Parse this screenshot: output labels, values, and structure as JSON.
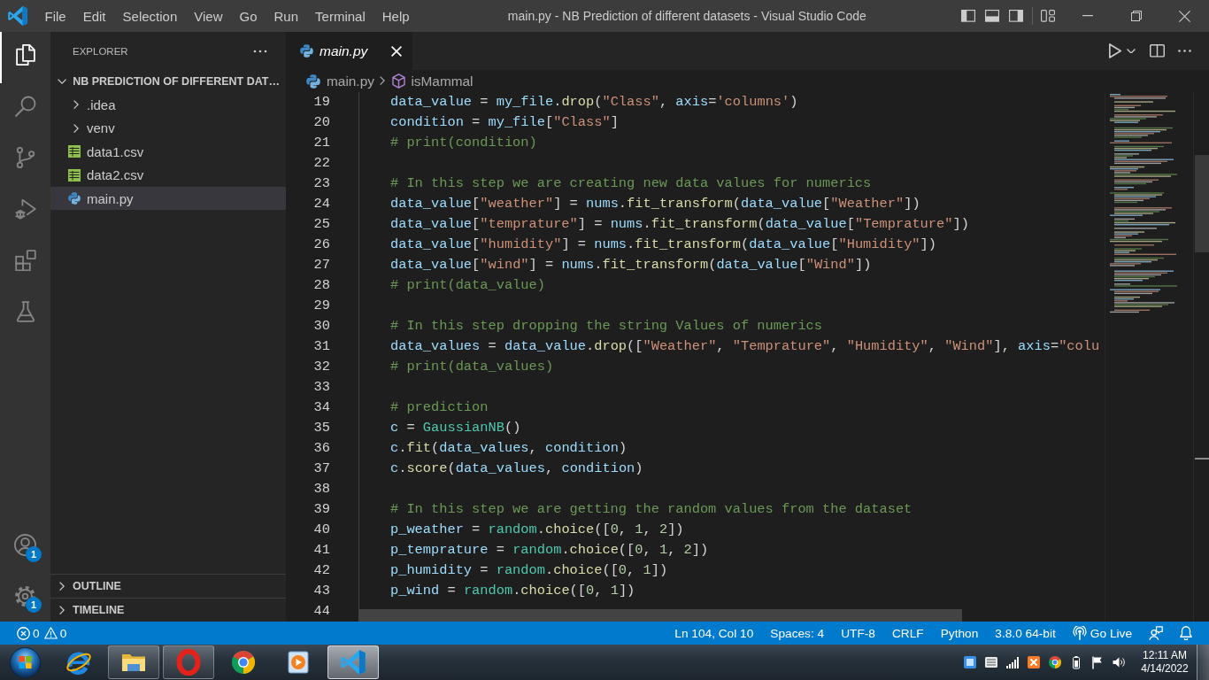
{
  "title_bar": {
    "menu": [
      "File",
      "Edit",
      "Selection",
      "View",
      "Go",
      "Run",
      "Terminal",
      "Help"
    ],
    "title": "main.py - NB Prediction of different datasets - Visual Studio Code"
  },
  "activity_bar": {
    "items": [
      {
        "selected": true
      },
      {
        "selected": false
      },
      {
        "selected": false
      },
      {
        "selected": false
      },
      {
        "selected": false
      },
      {
        "selected": false
      }
    ],
    "accounts_badge": "1",
    "settings_badge": "1"
  },
  "sidebar": {
    "title": "EXPLORER",
    "folder": {
      "label": "NB PREDICTION OF DIFFERENT DAT…",
      "expanded": true,
      "children": [
        {
          "kind": "folder",
          "label": ".idea",
          "expanded": false,
          "selected": false
        },
        {
          "kind": "folder",
          "label": "venv",
          "expanded": false,
          "selected": false
        },
        {
          "kind": "csv",
          "label": "data1.csv",
          "selected": false
        },
        {
          "kind": "csv",
          "label": "data2.csv",
          "selected": false
        },
        {
          "kind": "python",
          "label": "main.py",
          "selected": true
        }
      ]
    },
    "sections": [
      {
        "label": "OUTLINE",
        "expanded": false
      },
      {
        "label": "TIMELINE",
        "expanded": false
      }
    ]
  },
  "editor": {
    "tabs": [
      {
        "label": "main.py",
        "selected": true,
        "preview": true
      }
    ],
    "breadcrumbs": [
      {
        "kind": "file",
        "label": "main.py"
      },
      {
        "kind": "symbol",
        "label": "isMammal"
      }
    ],
    "lines": [
      {
        "number": "19",
        "tokens": [
          {
            "kind": "variable",
            "text": "data_value"
          },
          {
            "kind": "punctuation",
            "text": " = "
          },
          {
            "kind": "variable",
            "text": "my_file"
          },
          {
            "kind": "punctuation",
            "text": "."
          },
          {
            "kind": "function",
            "text": "drop"
          },
          {
            "kind": "punctuation",
            "text": "("
          },
          {
            "kind": "string",
            "text": "\"Class\""
          },
          {
            "kind": "punctuation",
            "text": ", "
          },
          {
            "kind": "variable",
            "text": "axis"
          },
          {
            "kind": "punctuation",
            "text": "="
          },
          {
            "kind": "string",
            "text": "'columns'"
          },
          {
            "kind": "punctuation",
            "text": ")"
          }
        ]
      },
      {
        "number": "20",
        "tokens": [
          {
            "kind": "variable",
            "text": "condition"
          },
          {
            "kind": "punctuation",
            "text": " = "
          },
          {
            "kind": "variable",
            "text": "my_file"
          },
          {
            "kind": "punctuation",
            "text": "["
          },
          {
            "kind": "string",
            "text": "\"Class\""
          },
          {
            "kind": "punctuation",
            "text": "]"
          }
        ]
      },
      {
        "number": "21",
        "tokens": [
          {
            "kind": "comment",
            "text": "# print(condition)"
          }
        ]
      },
      {
        "number": "22"
      },
      {
        "number": "23",
        "tokens": [
          {
            "kind": "comment",
            "text": "# In this step we are creating new data values for numerics"
          }
        ]
      },
      {
        "number": "24",
        "tokens": [
          {
            "kind": "variable",
            "text": "data_value"
          },
          {
            "kind": "punctuation",
            "text": "["
          },
          {
            "kind": "string",
            "text": "\"weather\""
          },
          {
            "kind": "punctuation",
            "text": "] = "
          },
          {
            "kind": "variable",
            "text": "nums"
          },
          {
            "kind": "punctuation",
            "text": "."
          },
          {
            "kind": "function",
            "text": "fit_transform"
          },
          {
            "kind": "punctuation",
            "text": "("
          },
          {
            "kind": "variable",
            "text": "data_value"
          },
          {
            "kind": "punctuation",
            "text": "["
          },
          {
            "kind": "string",
            "text": "\"Weather\""
          },
          {
            "kind": "punctuation",
            "text": "])"
          }
        ]
      },
      {
        "number": "25",
        "tokens": [
          {
            "kind": "variable",
            "text": "data_value"
          },
          {
            "kind": "punctuation",
            "text": "["
          },
          {
            "kind": "string",
            "text": "\"temprature\""
          },
          {
            "kind": "punctuation",
            "text": "] = "
          },
          {
            "kind": "variable",
            "text": "nums"
          },
          {
            "kind": "punctuation",
            "text": "."
          },
          {
            "kind": "function",
            "text": "fit_transform"
          },
          {
            "kind": "punctuation",
            "text": "("
          },
          {
            "kind": "variable",
            "text": "data_value"
          },
          {
            "kind": "punctuation",
            "text": "["
          },
          {
            "kind": "string",
            "text": "\"Temprature\""
          },
          {
            "kind": "punctuation",
            "text": "])"
          }
        ]
      },
      {
        "number": "26",
        "tokens": [
          {
            "kind": "variable",
            "text": "data_value"
          },
          {
            "kind": "punctuation",
            "text": "["
          },
          {
            "kind": "string",
            "text": "\"humidity\""
          },
          {
            "kind": "punctuation",
            "text": "] = "
          },
          {
            "kind": "variable",
            "text": "nums"
          },
          {
            "kind": "punctuation",
            "text": "."
          },
          {
            "kind": "function",
            "text": "fit_transform"
          },
          {
            "kind": "punctuation",
            "text": "("
          },
          {
            "kind": "variable",
            "text": "data_value"
          },
          {
            "kind": "punctuation",
            "text": "["
          },
          {
            "kind": "string",
            "text": "\"Humidity\""
          },
          {
            "kind": "punctuation",
            "text": "])"
          }
        ]
      },
      {
        "number": "27",
        "tokens": [
          {
            "kind": "variable",
            "text": "data_value"
          },
          {
            "kind": "punctuation",
            "text": "["
          },
          {
            "kind": "string",
            "text": "\"wind\""
          },
          {
            "kind": "punctuation",
            "text": "] = "
          },
          {
            "kind": "variable",
            "text": "nums"
          },
          {
            "kind": "punctuation",
            "text": "."
          },
          {
            "kind": "function",
            "text": "fit_transform"
          },
          {
            "kind": "punctuation",
            "text": "("
          },
          {
            "kind": "variable",
            "text": "data_value"
          },
          {
            "kind": "punctuation",
            "text": "["
          },
          {
            "kind": "string",
            "text": "\"Wind\""
          },
          {
            "kind": "punctuation",
            "text": "])"
          }
        ]
      },
      {
        "number": "28",
        "tokens": [
          {
            "kind": "comment",
            "text": "# print(data_value)"
          }
        ]
      },
      {
        "number": "29"
      },
      {
        "number": "30",
        "tokens": [
          {
            "kind": "comment",
            "text": "# In this step dropping the string Values of numerics"
          }
        ]
      },
      {
        "number": "31",
        "tokens": [
          {
            "kind": "variable",
            "text": "data_values"
          },
          {
            "kind": "punctuation",
            "text": " = "
          },
          {
            "kind": "variable",
            "text": "data_value"
          },
          {
            "kind": "punctuation",
            "text": "."
          },
          {
            "kind": "function",
            "text": "drop"
          },
          {
            "kind": "punctuation",
            "text": "(["
          },
          {
            "kind": "string",
            "text": "\"Weather\""
          },
          {
            "kind": "punctuation",
            "text": ", "
          },
          {
            "kind": "string",
            "text": "\"Temprature\""
          },
          {
            "kind": "punctuation",
            "text": ", "
          },
          {
            "kind": "string",
            "text": "\"Humidity\""
          },
          {
            "kind": "punctuation",
            "text": ", "
          },
          {
            "kind": "string",
            "text": "\"Wind\""
          },
          {
            "kind": "punctuation",
            "text": "], "
          },
          {
            "kind": "variable",
            "text": "axis"
          },
          {
            "kind": "punctuation",
            "text": "="
          },
          {
            "kind": "string",
            "text": "\"colu"
          }
        ]
      },
      {
        "number": "32",
        "tokens": [
          {
            "kind": "comment",
            "text": "# print(data_values)"
          }
        ]
      },
      {
        "number": "33"
      },
      {
        "number": "34",
        "tokens": [
          {
            "kind": "comment",
            "text": "# prediction"
          }
        ]
      },
      {
        "number": "35",
        "tokens": [
          {
            "kind": "variable",
            "text": "c"
          },
          {
            "kind": "punctuation",
            "text": " = "
          },
          {
            "kind": "class",
            "text": "GaussianNB"
          },
          {
            "kind": "punctuation",
            "text": "()"
          }
        ]
      },
      {
        "number": "36",
        "tokens": [
          {
            "kind": "variable",
            "text": "c"
          },
          {
            "kind": "punctuation",
            "text": "."
          },
          {
            "kind": "function",
            "text": "fit"
          },
          {
            "kind": "punctuation",
            "text": "("
          },
          {
            "kind": "variable",
            "text": "data_values"
          },
          {
            "kind": "punctuation",
            "text": ", "
          },
          {
            "kind": "variable",
            "text": "condition"
          },
          {
            "kind": "punctuation",
            "text": ")"
          }
        ]
      },
      {
        "number": "37",
        "tokens": [
          {
            "kind": "variable",
            "text": "c"
          },
          {
            "kind": "punctuation",
            "text": "."
          },
          {
            "kind": "function",
            "text": "score"
          },
          {
            "kind": "punctuation",
            "text": "("
          },
          {
            "kind": "variable",
            "text": "data_values"
          },
          {
            "kind": "punctuation",
            "text": ", "
          },
          {
            "kind": "variable",
            "text": "condition"
          },
          {
            "kind": "punctuation",
            "text": ")"
          }
        ]
      },
      {
        "number": "38"
      },
      {
        "number": "39",
        "tokens": [
          {
            "kind": "comment",
            "text": "# In this step we are getting the random values from the dataset"
          }
        ]
      },
      {
        "number": "40",
        "tokens": [
          {
            "kind": "variable",
            "text": "p_weather"
          },
          {
            "kind": "punctuation",
            "text": " = "
          },
          {
            "kind": "module",
            "text": "random"
          },
          {
            "kind": "punctuation",
            "text": "."
          },
          {
            "kind": "function",
            "text": "choice"
          },
          {
            "kind": "punctuation",
            "text": "(["
          },
          {
            "kind": "number",
            "text": "0"
          },
          {
            "kind": "punctuation",
            "text": ", "
          },
          {
            "kind": "number",
            "text": "1"
          },
          {
            "kind": "punctuation",
            "text": ", "
          },
          {
            "kind": "number",
            "text": "2"
          },
          {
            "kind": "punctuation",
            "text": "])"
          }
        ]
      },
      {
        "number": "41",
        "tokens": [
          {
            "kind": "variable",
            "text": "p_temprature"
          },
          {
            "kind": "punctuation",
            "text": " = "
          },
          {
            "kind": "module",
            "text": "random"
          },
          {
            "kind": "punctuation",
            "text": "."
          },
          {
            "kind": "function",
            "text": "choice"
          },
          {
            "kind": "punctuation",
            "text": "(["
          },
          {
            "kind": "number",
            "text": "0"
          },
          {
            "kind": "punctuation",
            "text": ", "
          },
          {
            "kind": "number",
            "text": "1"
          },
          {
            "kind": "punctuation",
            "text": ", "
          },
          {
            "kind": "number",
            "text": "2"
          },
          {
            "kind": "punctuation",
            "text": "])"
          }
        ]
      },
      {
        "number": "42",
        "tokens": [
          {
            "kind": "variable",
            "text": "p_humidity"
          },
          {
            "kind": "punctuation",
            "text": " = "
          },
          {
            "kind": "module",
            "text": "random"
          },
          {
            "kind": "punctuation",
            "text": "."
          },
          {
            "kind": "function",
            "text": "choice"
          },
          {
            "kind": "punctuation",
            "text": "(["
          },
          {
            "kind": "number",
            "text": "0"
          },
          {
            "kind": "punctuation",
            "text": ", "
          },
          {
            "kind": "number",
            "text": "1"
          },
          {
            "kind": "punctuation",
            "text": "])"
          }
        ]
      },
      {
        "number": "43",
        "tokens": [
          {
            "kind": "variable",
            "text": "p_wind"
          },
          {
            "kind": "punctuation",
            "text": " = "
          },
          {
            "kind": "module",
            "text": "random"
          },
          {
            "kind": "punctuation",
            "text": "."
          },
          {
            "kind": "function",
            "text": "choice"
          },
          {
            "kind": "punctuation",
            "text": "(["
          },
          {
            "kind": "number",
            "text": "0"
          },
          {
            "kind": "punctuation",
            "text": ", "
          },
          {
            "kind": "number",
            "text": "1"
          },
          {
            "kind": "punctuation",
            "text": "])"
          }
        ]
      },
      {
        "number": "44"
      }
    ]
  },
  "status_bar": {
    "errors": "0",
    "warnings": "0",
    "items": [
      "Ln 104, Col 10",
      "Spaces: 4",
      "UTF-8",
      "CRLF",
      "Python",
      "3.8.0 64-bit"
    ],
    "go_live": "Go Live"
  },
  "taskbar": {
    "apps": [
      {
        "running": false,
        "selected": false
      },
      {
        "running": true,
        "selected": false
      },
      {
        "running": true,
        "selected": false
      },
      {
        "running": false,
        "selected": false
      },
      {
        "running": false,
        "selected": false
      },
      {
        "running": true,
        "selected": true
      }
    ],
    "clock": {
      "time": "12:11 AM",
      "date": "4/14/2022"
    }
  }
}
